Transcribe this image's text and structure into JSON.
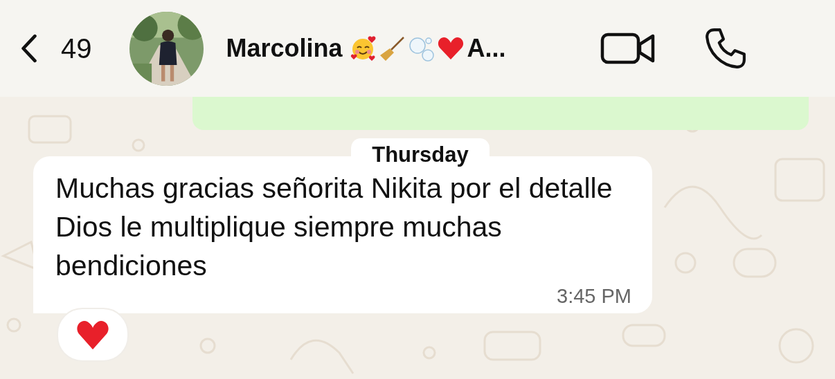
{
  "header": {
    "back_count": "49",
    "name": "Marcolina",
    "name_tail": "A..."
  },
  "messages": [
    {
      "kind": "outgoing_cut"
    },
    {
      "kind": "date",
      "text": "Thursday"
    },
    {
      "kind": "incoming",
      "text": "Muchas gracias señorita Nikita por el detalle Dios le multiplique siempre muchas bendiciones",
      "time": "3:45 PM",
      "reactions": [
        {
          "kind": "heart"
        }
      ]
    }
  ]
}
